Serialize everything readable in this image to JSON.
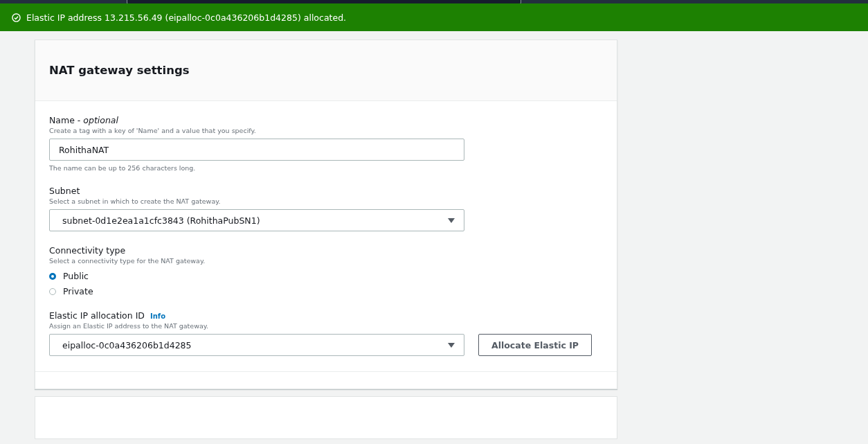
{
  "flash": {
    "message": "Elastic IP address 13.215.56.49 (eipalloc-0c0a436206b1d4285) allocated."
  },
  "panel": {
    "title": "NAT gateway settings",
    "fields": [
      {
        "kind": "text",
        "label": "Name - *optional*",
        "description": "Create a tag with a key of 'Name' and a value that you specify.",
        "value": "RohithaNAT",
        "constraint": "The name can be up to 256 characters long."
      },
      {
        "kind": "select",
        "label": "Subnet",
        "description": "Select a subnet in which to create the NAT gateway.",
        "value": "subnet-0d1e2ea1a1cfc3843 (RohithaPubSN1)"
      },
      {
        "kind": "radio",
        "label": "Connectivity type",
        "description": "Select a connectivity type for the NAT gateway.",
        "options": [
          {
            "label": "Public",
            "selected": true
          },
          {
            "label": "Private",
            "selected": false
          }
        ]
      },
      {
        "kind": "select",
        "label": "Elastic IP allocation ID",
        "info": "Info",
        "description": "Assign an Elastic IP address to the NAT gateway.",
        "value": "eipalloc-0c0a436206b1d4285",
        "button": "Allocate Elastic IP"
      }
    ]
  }
}
